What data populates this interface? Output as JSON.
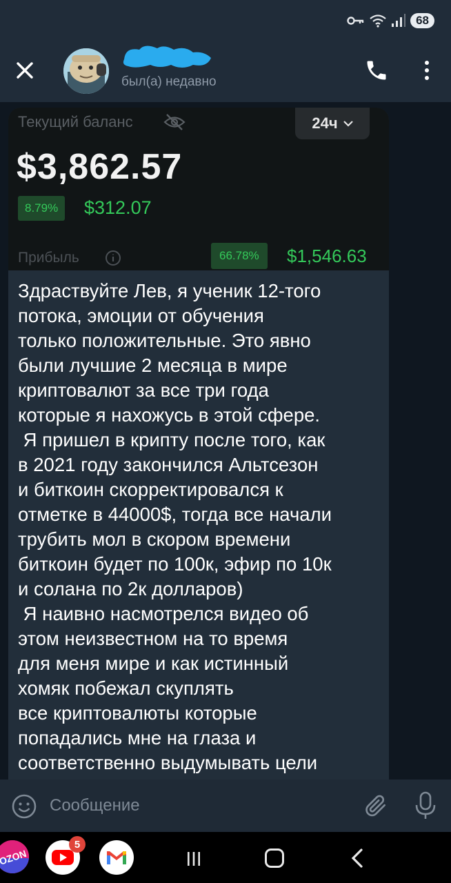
{
  "status_bar": {
    "battery": "68",
    "icons": [
      "key-icon",
      "wifi-icon",
      "signal-icon"
    ]
  },
  "header": {
    "last_seen": "был(а) недавно",
    "icons": [
      "close-icon",
      "phone-icon",
      "more-vertical-icon"
    ],
    "accent_color": "#2aabee"
  },
  "message": {
    "screenshot": {
      "balance_label": "Текущий баланс",
      "period": "24ч",
      "balance": "$3,862.57",
      "change_percent": "8.79%",
      "change_amount": "$312.07",
      "profit_label": "Прибыль",
      "profit_percent": "66.78%",
      "profit_amount": "$1,546.63",
      "positive_color": "#34c95a"
    },
    "text": "Здраствуйте Лев, я ученик 12-того\nпотока, эмоции от обучения\nтолько положительные. Это явно\nбыли лучшие 2 месяца в мире\nкриптовалют за все три года\nкоторые я нахожусь в этой сфере.\n Я пришел в крипту после того, как\nв 2021 году закончился Альтсезон\nи биткоин скорректировался к\nотметке в 44000$, тогда все начали\nтрубить мол в скором времени\nбиткоин будет по 100к, эфир по 10к\nи солана по 2к долларов)\n Я наивно насмотрелся видео об\nэтом неизвестном на то время\nдля меня мире и как истинный\nхомяк побежал скуплять\nвсе криптовалюты которые\nпопадались мне на глаза и\nсоответственно выдумывать цели"
  },
  "composer": {
    "placeholder": "Сообщение",
    "icons": [
      "emoji-icon",
      "attach-icon",
      "mic-icon"
    ]
  },
  "navbar": {
    "apps": [
      "ozon",
      "youtube",
      "gmail"
    ],
    "ozon_label": "OZON",
    "youtube_badge": "5",
    "buttons": [
      "recents-icon",
      "home-icon",
      "back-icon"
    ]
  }
}
